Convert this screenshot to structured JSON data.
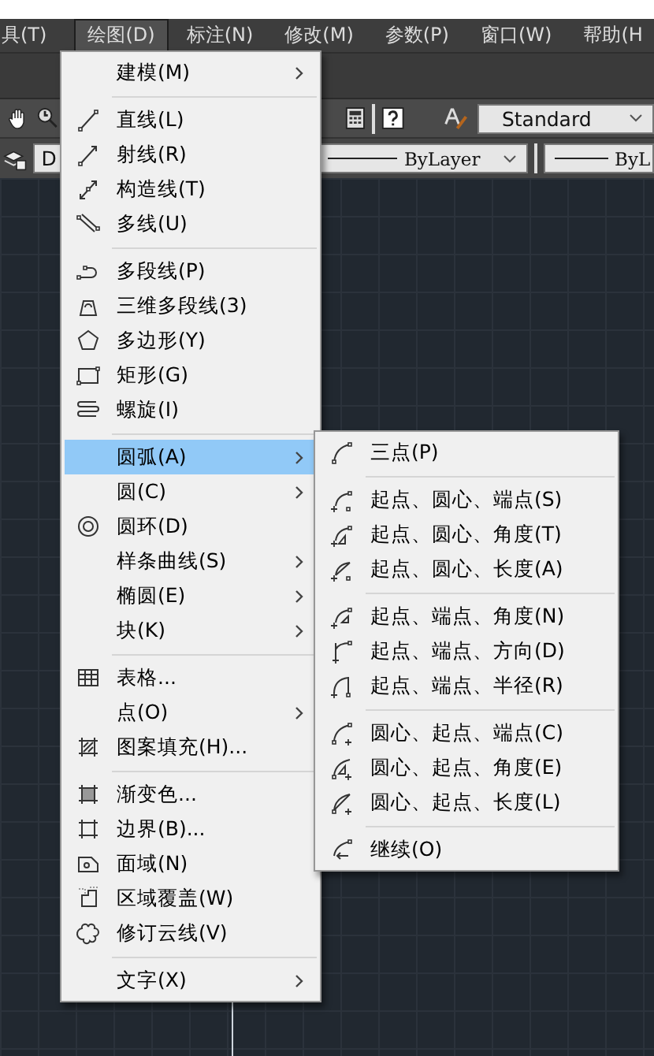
{
  "menubar": [
    {
      "label": "具(T)",
      "selected": false
    },
    {
      "label": "绘图(D)",
      "selected": true
    },
    {
      "label": "标注(N)",
      "selected": false
    },
    {
      "label": "修改(M)",
      "selected": false
    },
    {
      "label": "参数(P)",
      "selected": false
    },
    {
      "label": "窗口(W)",
      "selected": false
    },
    {
      "label": "帮助(H",
      "selected": false
    }
  ],
  "toolbar": {
    "layer_combo": "D",
    "text_style": "Standard",
    "color_combo": "ByLayer",
    "linetype_combo": "ByL"
  },
  "draw_menu": {
    "items": [
      {
        "kind": "item",
        "label": "建模(M)",
        "submenu": true,
        "selected": false
      },
      {
        "kind": "separator"
      },
      {
        "kind": "item",
        "label": "直线(L)",
        "submenu": false,
        "selected": false
      },
      {
        "kind": "item",
        "label": "射线(R)",
        "submenu": false,
        "selected": false
      },
      {
        "kind": "item",
        "label": "构造线(T)",
        "submenu": false,
        "selected": false
      },
      {
        "kind": "item",
        "label": "多线(U)",
        "submenu": false,
        "selected": false
      },
      {
        "kind": "separator"
      },
      {
        "kind": "item",
        "label": "多段线(P)",
        "submenu": false,
        "selected": false
      },
      {
        "kind": "item",
        "label": "三维多段线(3)",
        "submenu": false,
        "selected": false
      },
      {
        "kind": "item",
        "label": "多边形(Y)",
        "submenu": false,
        "selected": false
      },
      {
        "kind": "item",
        "label": "矩形(G)",
        "submenu": false,
        "selected": false
      },
      {
        "kind": "item",
        "label": "螺旋(I)",
        "submenu": false,
        "selected": false
      },
      {
        "kind": "separator"
      },
      {
        "kind": "item",
        "label": "圆弧(A)",
        "submenu": true,
        "selected": true
      },
      {
        "kind": "item",
        "label": "圆(C)",
        "submenu": true,
        "selected": false
      },
      {
        "kind": "item",
        "label": "圆环(D)",
        "submenu": false,
        "selected": false
      },
      {
        "kind": "item",
        "label": "样条曲线(S)",
        "submenu": true,
        "selected": false
      },
      {
        "kind": "item",
        "label": "椭圆(E)",
        "submenu": true,
        "selected": false
      },
      {
        "kind": "item",
        "label": "块(K)",
        "submenu": true,
        "selected": false
      },
      {
        "kind": "separator"
      },
      {
        "kind": "item",
        "label": "表格...",
        "submenu": false,
        "selected": false
      },
      {
        "kind": "item",
        "label": "点(O)",
        "submenu": true,
        "selected": false
      },
      {
        "kind": "item",
        "label": "图案填充(H)...",
        "submenu": false,
        "selected": false
      },
      {
        "kind": "separator"
      },
      {
        "kind": "item",
        "label": "渐变色...",
        "submenu": false,
        "selected": false
      },
      {
        "kind": "item",
        "label": "边界(B)...",
        "submenu": false,
        "selected": false
      },
      {
        "kind": "item",
        "label": "面域(N)",
        "submenu": false,
        "selected": false
      },
      {
        "kind": "item",
        "label": "区域覆盖(W)",
        "submenu": false,
        "selected": false
      },
      {
        "kind": "item",
        "label": "修订云线(V)",
        "submenu": false,
        "selected": false
      },
      {
        "kind": "separator"
      },
      {
        "kind": "item",
        "label": "文字(X)",
        "submenu": true,
        "selected": false
      }
    ]
  },
  "arc_submenu": {
    "items": [
      {
        "kind": "item",
        "label": "三点(P)",
        "submenu": false,
        "selected": false
      },
      {
        "kind": "separator"
      },
      {
        "kind": "item",
        "label": "起点、圆心、端点(S)",
        "submenu": false,
        "selected": false
      },
      {
        "kind": "item",
        "label": "起点、圆心、角度(T)",
        "submenu": false,
        "selected": false
      },
      {
        "kind": "item",
        "label": "起点、圆心、长度(A)",
        "submenu": false,
        "selected": false
      },
      {
        "kind": "separator"
      },
      {
        "kind": "item",
        "label": "起点、端点、角度(N)",
        "submenu": false,
        "selected": false
      },
      {
        "kind": "item",
        "label": "起点、端点、方向(D)",
        "submenu": false,
        "selected": false
      },
      {
        "kind": "item",
        "label": "起点、端点、半径(R)",
        "submenu": false,
        "selected": false
      },
      {
        "kind": "separator"
      },
      {
        "kind": "item",
        "label": "圆心、起点、端点(C)",
        "submenu": false,
        "selected": false
      },
      {
        "kind": "item",
        "label": "圆心、起点、角度(E)",
        "submenu": false,
        "selected": false
      },
      {
        "kind": "item",
        "label": "圆心、起点、长度(L)",
        "submenu": false,
        "selected": false
      },
      {
        "kind": "separator"
      },
      {
        "kind": "item",
        "label": "继续(O)",
        "submenu": false,
        "selected": false
      }
    ]
  }
}
